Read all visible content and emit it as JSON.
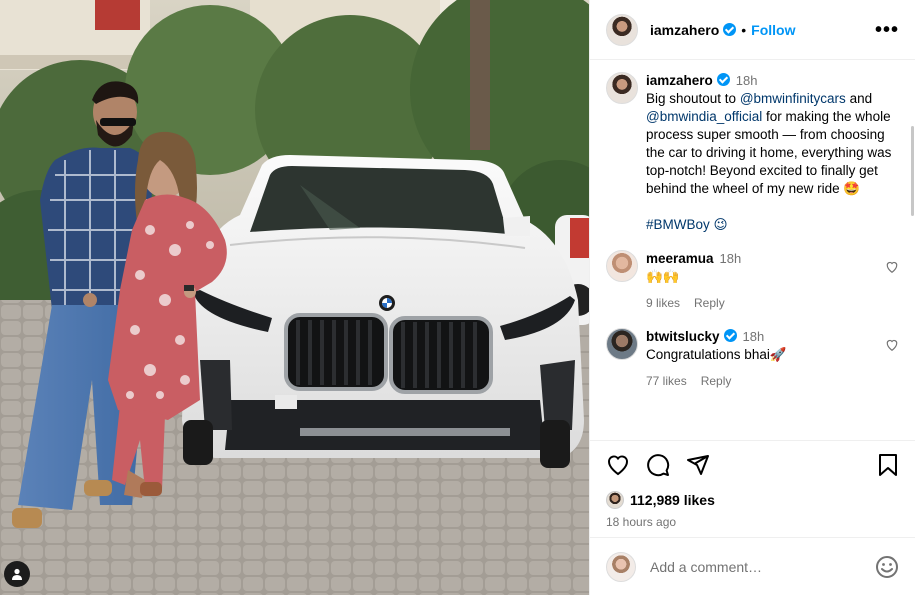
{
  "post": {
    "author": "iamzahero",
    "follow_label": "Follow",
    "more_label": "•••",
    "separator": "•"
  },
  "caption": {
    "author": "iamzahero",
    "time": "18h",
    "text_1": "Big shoutout to ",
    "mention_1": "@bmwinfinitycars",
    "text_2": " and ",
    "mention_2": "@bmwindia_official",
    "text_3": " for making the whole process super smooth — from choosing the car to driving it home, everything was top-notch! Beyond excited to finally get behind the wheel of my new ride 🤩",
    "hashtag": "#BMWBoy",
    "hashtag_emoji": "😉"
  },
  "comments": [
    {
      "author": "meeramua",
      "time": "18h",
      "text": "🙌🙌",
      "likes": "9 likes",
      "reply": "Reply",
      "verified": false
    },
    {
      "author": "btwitslucky",
      "time": "18h",
      "text": "Congratulations bhai🚀",
      "likes": "77 likes",
      "reply": "Reply",
      "verified": true
    }
  ],
  "stats": {
    "likes": "112,989 likes",
    "posted": "18 hours ago"
  },
  "composer": {
    "placeholder": "Add a comment…"
  },
  "colors": {
    "accent": "#0095f6",
    "mention": "#00376b",
    "muted": "#737373"
  },
  "icons": [
    "heart-icon",
    "comment-icon",
    "share-icon",
    "bookmark-icon",
    "emoji-icon",
    "tag-user-icon",
    "more-options-icon",
    "verified-icon"
  ]
}
